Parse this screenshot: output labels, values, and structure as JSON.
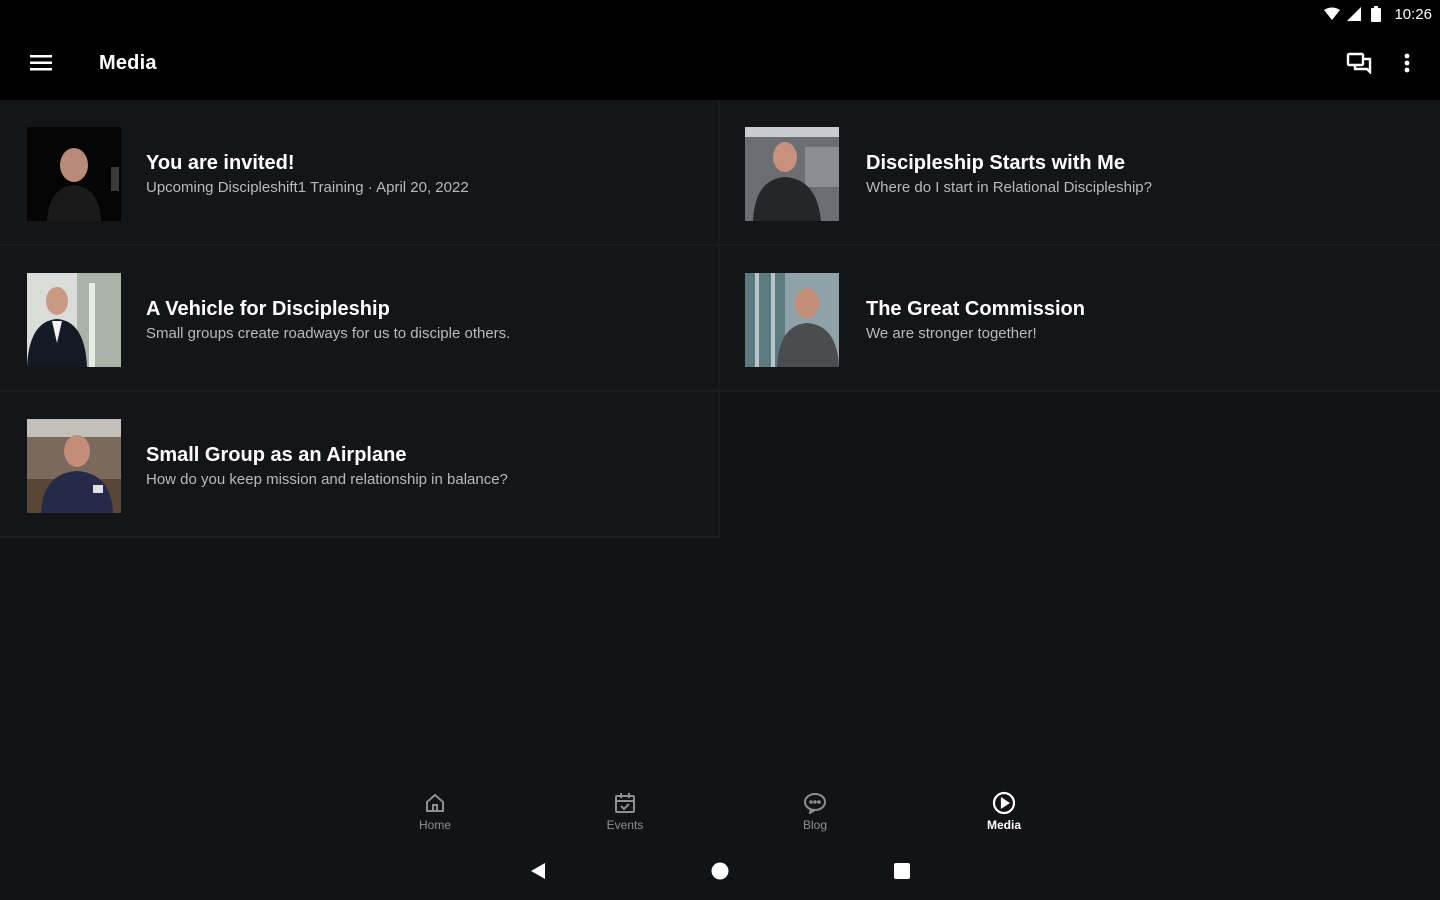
{
  "status_bar": {
    "time": "10:26"
  },
  "app_bar": {
    "title": "Media"
  },
  "media_items": [
    {
      "title": "You are invited!",
      "subtitle": "Upcoming Discipleshift1 Training · April 20, 2022"
    },
    {
      "title": "Discipleship Starts with Me",
      "subtitle": "Where do I start in Relational Discipleship?"
    },
    {
      "title": "A Vehicle for Discipleship",
      "subtitle": "Small groups create roadways for us to disciple others."
    },
    {
      "title": "The Great Commission",
      "subtitle": "We are stronger together!"
    },
    {
      "title": "Small Group as an Airplane",
      "subtitle": "How do you keep mission and relationship in balance?"
    }
  ],
  "bottom_nav": {
    "items": [
      {
        "label": "Home",
        "icon": "home-icon"
      },
      {
        "label": "Events",
        "icon": "calendar-icon"
      },
      {
        "label": "Blog",
        "icon": "chat-bubble-icon"
      },
      {
        "label": "Media",
        "icon": "play-circle-icon"
      }
    ],
    "active": "Media"
  },
  "colors": {
    "background": "#121316",
    "app_bar": "#000000",
    "card": "#141519",
    "subtitle": "#b9babd",
    "nav_inactive": "#8e8f93",
    "nav_active": "#ffffff"
  }
}
